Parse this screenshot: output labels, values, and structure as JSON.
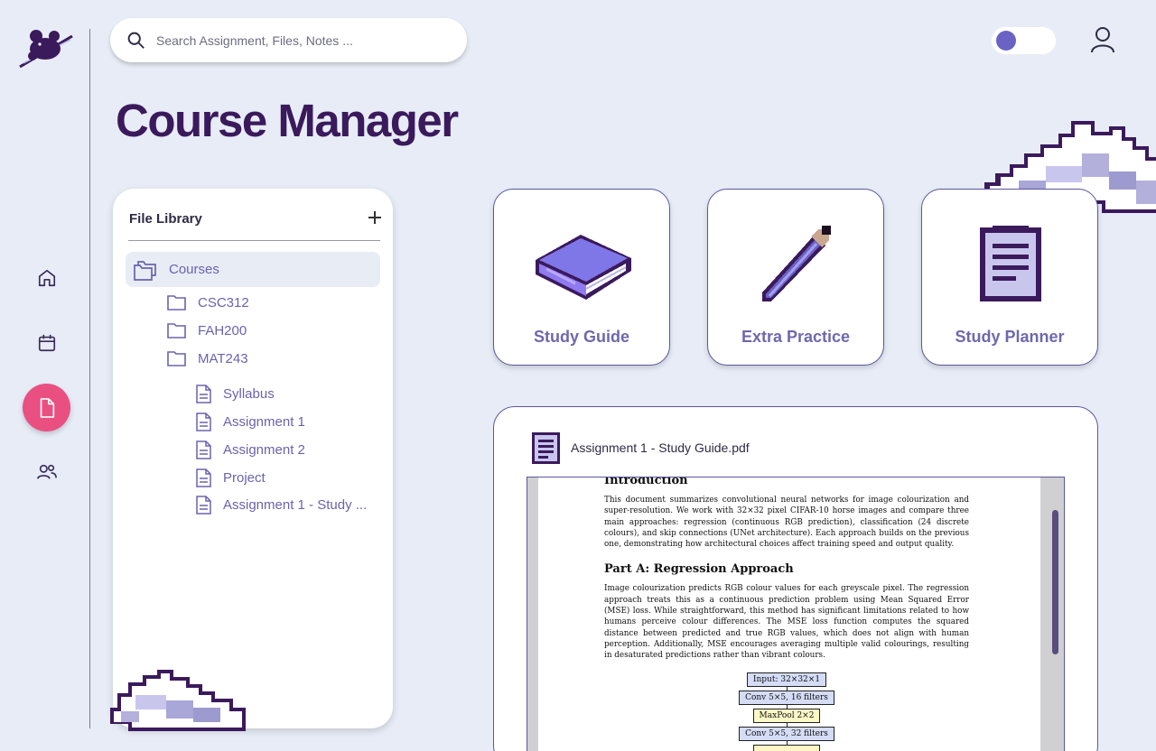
{
  "search": {
    "placeholder": "Search Assignment, Files, Notes ..."
  },
  "page_title": "Course Manager",
  "nav": {
    "items": [
      {
        "icon": "home-icon"
      },
      {
        "icon": "calendar-icon"
      },
      {
        "icon": "document-icon",
        "active": true
      },
      {
        "icon": "users-icon"
      }
    ]
  },
  "library": {
    "title": "File Library",
    "root": "Courses",
    "folders": [
      "CSC312",
      "FAH200",
      "MAT243"
    ],
    "files": [
      "Syllabus",
      "Assignment 1",
      "Assignment 2",
      "Project",
      "Assignment 1 - Study ..."
    ]
  },
  "cards": [
    {
      "label": "Study Guide",
      "icon": "book-icon"
    },
    {
      "label": "Extra Practice",
      "icon": "pencil-icon"
    },
    {
      "label": "Study Planner",
      "icon": "notepad-icon"
    }
  ],
  "preview": {
    "filename": "Assignment 1 - Study Guide.pdf",
    "doc": {
      "intro_heading": "Introduction",
      "intro_text": "This document summarizes convolutional neural networks for image colourization and super-resolution. We work with 32×32 pixel CIFAR-10 horse images and compare three main approaches: regression (continuous RGB prediction), classification (24 discrete colours), and skip connections (UNet architecture). Each approach builds on the previous one, demonstrating how architectural choices affect training speed and output quality.",
      "part_a_heading": "Part A: Regression Approach",
      "part_a_text": "Image colourization predicts RGB colour values for each greyscale pixel. The regression approach treats this as a continuous prediction problem using Mean Squared Error (MSE) loss. While straightforward, this method has significant limitations related to how humans perceive colour differences. The MSE loss function computes the squared distance between predicted and true RGB values, which does not align with human perception. Additionally, MSE encourages averaging multiple valid colourings, resulting in desaturated predictions rather than vibrant colours.",
      "flow": [
        "Input: 32×32×1",
        "Conv 5×5, 16 filters",
        "MaxPool 2×2",
        "Conv 5×5, 32 filters"
      ]
    }
  },
  "colors": {
    "background": "#e7ecf6",
    "accent_pink": "#ea4f82",
    "title_purple": "#3b1a5c",
    "label_purple": "#6e68ad",
    "toggle_knob": "#6a63c4"
  }
}
